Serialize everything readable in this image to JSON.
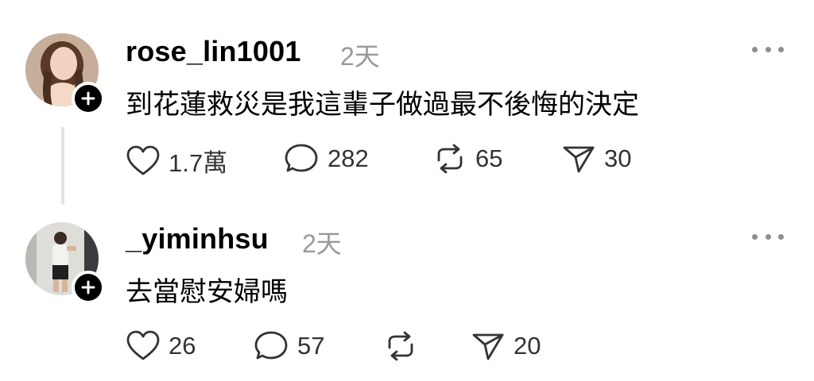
{
  "posts": [
    {
      "username": "rose_lin1001",
      "time": "2天",
      "text": "到花蓮救災是我這輩子做過最不後悔的決定",
      "likes": "1.7萬",
      "comments": "282",
      "reposts": "65",
      "shares": "30"
    },
    {
      "username": "_yiminhsu",
      "time": "2天",
      "text": "去當慰安婦嗎",
      "likes": "26",
      "comments": "57",
      "reposts": "",
      "shares": "20"
    }
  ],
  "icons": {
    "like": "heart-icon",
    "comment": "comment-bubble-icon",
    "repost": "repost-icon",
    "share": "send-icon",
    "more": "more-dots-icon",
    "follow": "plus-icon"
  },
  "colors": {
    "text": "#000000",
    "muted": "#999999",
    "icon": "#333333",
    "thread_line": "#e3e3e3"
  }
}
